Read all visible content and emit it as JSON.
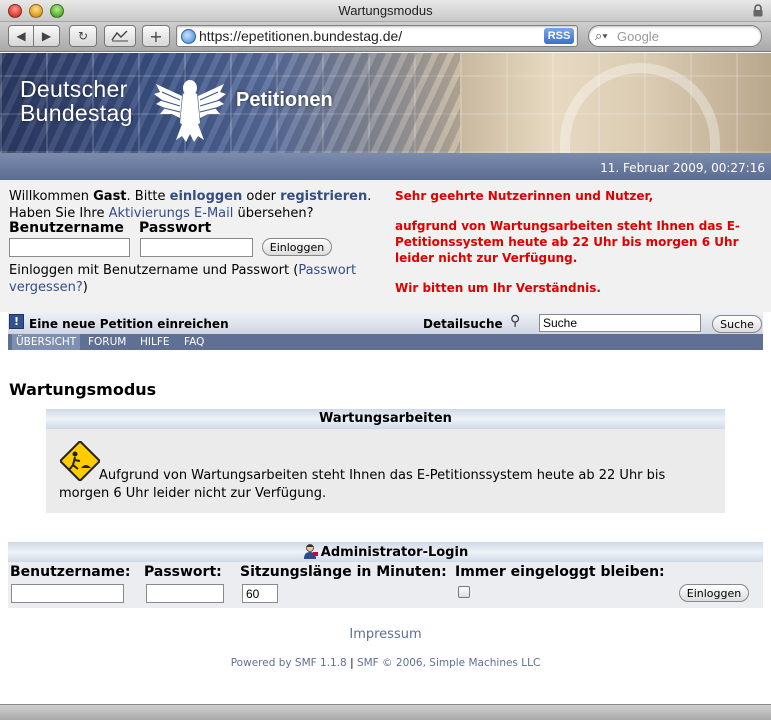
{
  "window": {
    "title": "Wartungsmodus"
  },
  "browser": {
    "url": "https://epetitionen.bundestag.de/",
    "rss_label": "RSS",
    "search_placeholder": "Google"
  },
  "banner": {
    "org_line1": "Deutscher",
    "org_line2": "Bundestag",
    "section": "Petitionen"
  },
  "datebar": {
    "datetime": "11. Februar 2009, 00:27:16"
  },
  "welcome": {
    "w1": "Willkommen ",
    "guest": "Gast",
    "w2": ". Bitte ",
    "login_link": "einloggen",
    "w3": " oder ",
    "register_link": "registrieren",
    "w4": ".",
    "w5": "Haben Sie Ihre ",
    "activation_link": "Aktivierungs E-Mail",
    "w6": " übersehen?",
    "username_label": "Benutzername",
    "password_label": "Passwort",
    "login_button": "Einloggen",
    "hint_text": "Einloggen mit Benutzername und Passwort (",
    "forgot_link": "Passwort vergessen?",
    "hint_end": ")"
  },
  "notice": {
    "greeting": "Sehr geehrte Nutzerinnen und Nutzer,",
    "body": "aufgrund von Wartungsarbeiten steht Ihnen das E-Petitionssystem heute ab 22 Uhr bis morgen 6 Uhr leider nicht zur Verfügung.",
    "closing": "Wir bitten um Ihr Verständnis."
  },
  "petitionbar": {
    "new_petition": "Eine neue Petition einreichen",
    "detail_search": "Detailsuche",
    "search_value": "Suche",
    "search_button": "Suche"
  },
  "nav": {
    "items": [
      {
        "label": "ÜBERSICHT"
      },
      {
        "label": "FORUM"
      },
      {
        "label": "HILFE"
      },
      {
        "label": "FAQ"
      }
    ]
  },
  "main": {
    "title": "Wartungsmodus",
    "box_title": "Wartungsarbeiten",
    "box_text": "Aufgrund von Wartungsarbeiten steht Ihnen das E-Petitionssystem heute ab 22 Uhr bis morgen 6 Uhr leider nicht zur Verfügung."
  },
  "admin": {
    "title": "Administrator-Login",
    "username_label": "Benutzername:",
    "password_label": "Passwort:",
    "session_label": "Sitzungslänge in Minuten:",
    "session_value": "60",
    "stay_logged_label": "Immer eingeloggt bleiben:",
    "login_button": "Einloggen"
  },
  "footer": {
    "impressum": "Impressum",
    "powered": "Powered by SMF 1.1.8",
    "sep": " | ",
    "copyright": "SMF © 2006, Simple Machines LLC"
  }
}
